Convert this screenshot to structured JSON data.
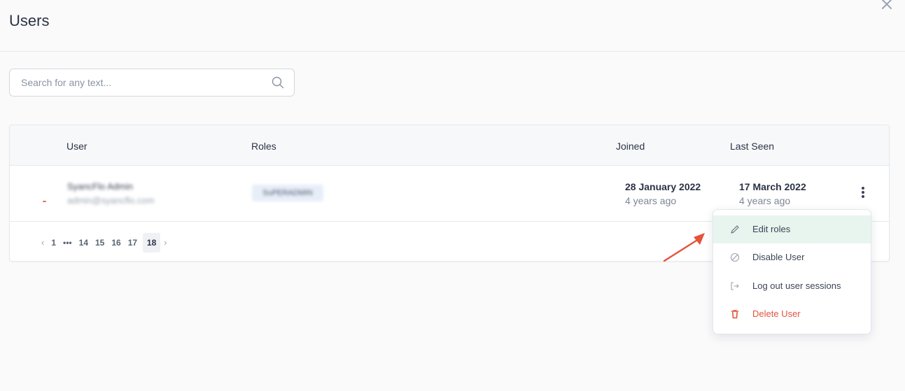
{
  "page": {
    "title": "Users"
  },
  "search": {
    "placeholder": "Search for any text..."
  },
  "table": {
    "headers": {
      "user": "User",
      "roles": "Roles",
      "joined": "Joined",
      "last_seen": "Last Seen"
    },
    "rows": [
      {
        "name": "SyancFlo Admin",
        "email": "admin@syancflo.com",
        "role": "SuPERADMIN",
        "joined_date": "28 January 2022",
        "joined_ago": "4 years ago",
        "last_seen_date": "17 March 2022",
        "last_seen_ago": "4 years ago"
      }
    ]
  },
  "pagination": {
    "pages_start": [
      "1"
    ],
    "ellipsis": "•••",
    "pages_end": [
      "14",
      "15",
      "16",
      "17"
    ],
    "current": "18",
    "prev": "‹",
    "next": "›"
  },
  "menu": {
    "items": [
      {
        "label": "Edit roles",
        "icon": "pencil-icon"
      },
      {
        "label": "Disable User",
        "icon": "ban-icon"
      },
      {
        "label": "Log out user sessions",
        "icon": "logout-icon"
      },
      {
        "label": "Delete User",
        "icon": "trash-icon"
      }
    ]
  },
  "colors": {
    "accent_hover": "#e7f5ee",
    "danger": "#e5533a",
    "annotation_arrow": "#e5533a"
  }
}
